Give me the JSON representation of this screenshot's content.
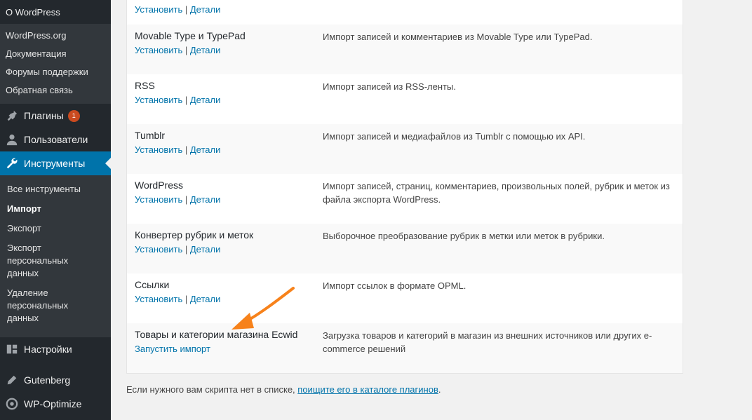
{
  "sidebar": {
    "about": "О WordPress",
    "about_sub": [
      "WordPress.org",
      "Документация",
      "Форумы поддержки",
      "Обратная связь"
    ],
    "plugins_label": "Плагины",
    "plugins_badge": "1",
    "users_label": "Пользователи",
    "tools_label": "Инструменты",
    "tools_sub": [
      "Все инструменты",
      "Импорт",
      "Экспорт",
      "Экспорт персональных данных",
      "Удаление персональных данных"
    ],
    "settings_label": "Настройки",
    "gutenberg_label": "Gutenberg",
    "wpoptimize_label": "WP-Optimize",
    "icons": [
      "plugin-icon",
      "users-icon",
      "wrench-icon",
      "settings-icon",
      "pencil-icon",
      "wp-optimize-icon"
    ],
    "accent_color": "#0073aa"
  },
  "importers": [
    {
      "name": "",
      "install": "Установить",
      "sep": "|",
      "details": "Детали",
      "description": ""
    },
    {
      "name": "Movable Type и TypePad",
      "install": "Установить",
      "sep": "|",
      "details": "Детали",
      "description": "Импорт записей и комментариев из Movable Type или TypePad."
    },
    {
      "name": "RSS",
      "install": "Установить",
      "sep": "|",
      "details": "Детали",
      "description": "Импорт записей из RSS-ленты."
    },
    {
      "name": "Tumblr",
      "install": "Установить",
      "sep": "|",
      "details": "Детали",
      "description": "Импорт записей и медиафайлов из Tumblr с помощью их API."
    },
    {
      "name": "WordPress",
      "install": "Установить",
      "sep": "|",
      "details": "Детали",
      "description": "Импорт записей, страниц, комментариев, произвольных полей, рубрик и меток из файла экспорта WordPress."
    },
    {
      "name": "Конвертер рубрик и меток",
      "install": "Установить",
      "sep": "|",
      "details": "Детали",
      "description": "Выборочное преобразование рубрик в метки или меток в рубрики."
    },
    {
      "name": "Ссылки",
      "install": "Установить",
      "sep": "|",
      "details": "Детали",
      "description": "Импорт ссылок в формате OPML."
    }
  ],
  "ecwid": {
    "name": "Товары и категории магазина Ecwid",
    "run": "Запустить импорт",
    "description": "Загрузка товаров и категорий в магазин из внешних источников или других e-commerce решений"
  },
  "footer": {
    "text": "Если нужного вам скрипта нет в списке, ",
    "link": "поищите его в каталоге плагинов",
    "end": "."
  },
  "annotation_arrow_color": "#f7821b"
}
